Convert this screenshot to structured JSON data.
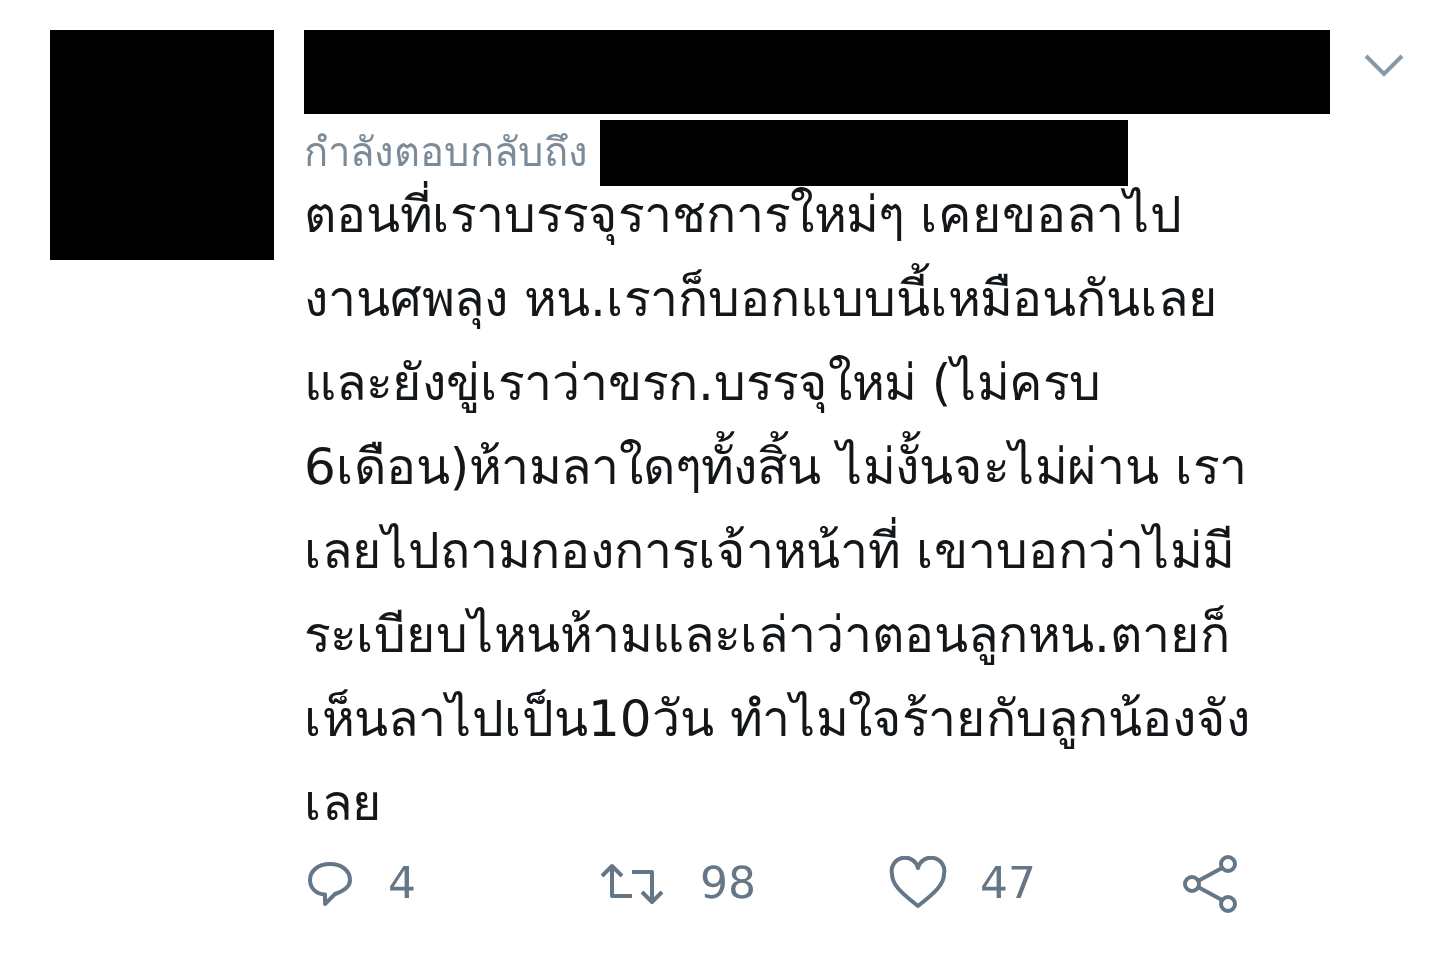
{
  "tweet": {
    "replying_to": "กำลังตอบกลับถึง",
    "body": [
      "ตอนที่เราบรรจุราชการใหม่ๆ เคยขอลาไป",
      "งานศพลุง หน.เราก็บอกแบบนี้เหมือนกันเลย",
      "และยังขู่เราว่าขรก.บรรจุใหม่ (ไม่ครบ",
      "6เดือน)ห้ามลาใดๆทั้งสิ้น ไม่งั้นจะไม่ผ่าน เรา",
      "เลยไปถามกองการเจ้าหน้าที่ เขาบอกว่าไม่มี",
      "ระเบียบไหนห้ามและเล่าว่าตอนลูกหน.ตายก็",
      "เห็นลาไปเป็น10วัน ทำไมใจร้ายกับลูกน้องจัง",
      "เลย"
    ],
    "actions": [
      {
        "kind": "reply",
        "count": "4"
      },
      {
        "kind": "retweet",
        "count": "98"
      },
      {
        "kind": "like",
        "count": "47"
      },
      {
        "kind": "share"
      }
    ]
  }
}
